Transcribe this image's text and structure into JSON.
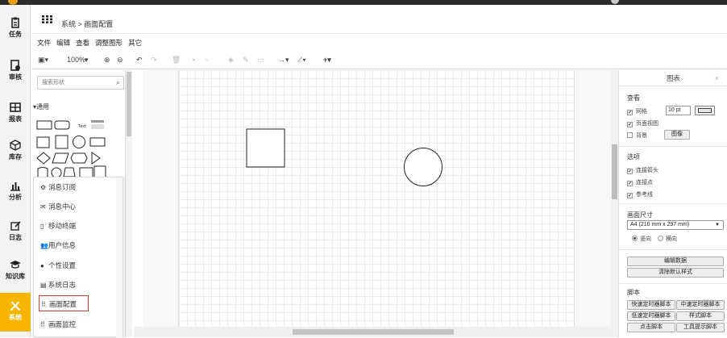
{
  "nav": {
    "items": [
      {
        "label": "任务",
        "icon": "clipboard-icon"
      },
      {
        "label": "审核",
        "icon": "audit-icon"
      },
      {
        "label": "报表",
        "icon": "table-icon"
      },
      {
        "label": "库存",
        "icon": "box-icon"
      },
      {
        "label": "分析",
        "icon": "bar-chart-icon"
      },
      {
        "label": "日志",
        "icon": "edit-icon"
      },
      {
        "label": "知识库",
        "icon": "graduation-cap-icon"
      },
      {
        "label": "系统",
        "icon": "tools-icon"
      }
    ],
    "active_index": 7,
    "active_color": "#f7b500"
  },
  "header": {
    "breadcrumb": "系统 > 画面配置"
  },
  "menubar": {
    "items": [
      "文件",
      "编辑",
      "查看",
      "调整图形",
      "其它"
    ]
  },
  "toolbar": {
    "zoom": "100%"
  },
  "shapes": {
    "search_placeholder": "搜索形状",
    "section": "通用"
  },
  "dropdown": {
    "items": [
      {
        "label": "消息订阅",
        "icon": "subscribe-icon"
      },
      {
        "label": "消息中心",
        "icon": "mail-icon"
      },
      {
        "label": "移动终端",
        "icon": "mobile-icon"
      },
      {
        "label": "用户信息",
        "icon": "users-icon"
      },
      {
        "label": "个性设置",
        "icon": "settings-icon"
      },
      {
        "label": "系统日志",
        "icon": "log-icon"
      },
      {
        "label": "画面配置",
        "icon": "grid-icon"
      },
      {
        "label": "画面监控",
        "icon": "grid-icon"
      }
    ],
    "selected_index": 6
  },
  "panel": {
    "title": "图表",
    "view_heading": "查看",
    "grid_label": "网格",
    "grid_size": "10 pt",
    "page_view_label": "页面视图",
    "background_label": "背景",
    "image_button": "图像",
    "options_heading": "选项",
    "connect_arrows": "连接箭头",
    "connect_points": "连接点",
    "guides": "参考线",
    "paper_heading": "画面尺寸",
    "paper_size": "A4 (210 mm x 297 mm)",
    "portrait": "竖向",
    "landscape": "横向",
    "edit_data": "编辑数据",
    "clear_style": "清除默认样式",
    "script_heading": "脚本",
    "scripts": [
      "快速定时器脚本",
      "中速定时器脚本",
      "低速定时器脚本",
      "样式脚本",
      "点击脚本",
      "工具提示脚本"
    ]
  }
}
